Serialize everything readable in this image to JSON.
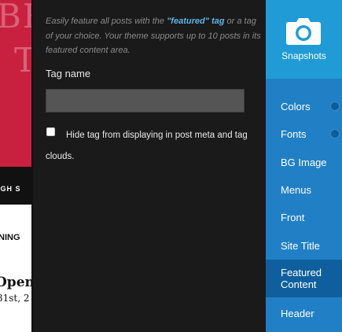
{
  "preview": {
    "hero_line1": "BRE",
    "hero_line2": "T",
    "nav_text": "IGH S",
    "text1": "NING",
    "text2": "Open",
    "text3": "31st, 2"
  },
  "panel": {
    "help_prefix": "Easily feature all posts with the ",
    "help_tag": "\"featured\" tag",
    "help_suffix": " or a tag of your choice. Your theme supports up to 10 posts in its featured content area.",
    "tag_label": "Tag name",
    "tag_value": "",
    "hide_checkbox_label": "Hide tag from displaying in post meta and tag clouds."
  },
  "menu": {
    "snapshots_label": "Snapshots",
    "items": [
      {
        "label": "Colors"
      },
      {
        "label": "Fonts"
      },
      {
        "label": "BG Image"
      },
      {
        "label": "Menus"
      },
      {
        "label": "Front"
      },
      {
        "label": "Site Title"
      },
      {
        "label_line1": "Featured",
        "label_line2": "Content"
      },
      {
        "label": "Header"
      }
    ]
  },
  "colors": {
    "panel_bg": "#1a1a1a",
    "menu_bg": "#2180c5",
    "menu_active": "#0f5f9e",
    "snapshots_bg": "#209bd6",
    "accent_tag": "#5bb6e8"
  }
}
